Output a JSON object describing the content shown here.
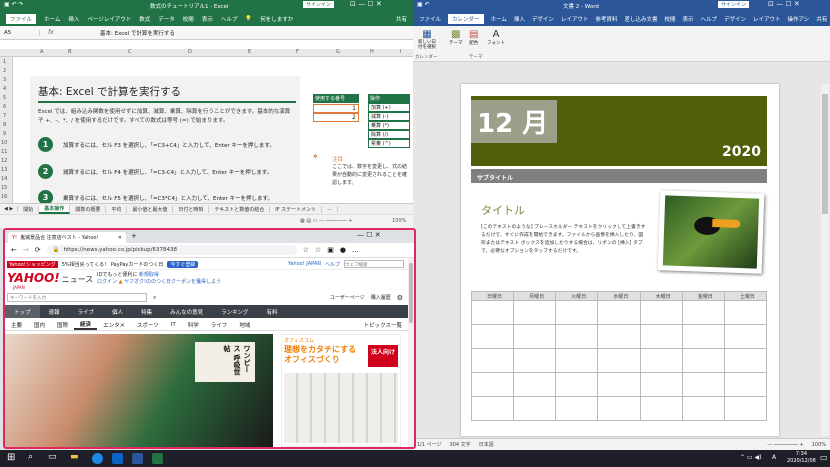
{
  "excel": {
    "title": "数式のチュートリアル1 - Excel",
    "signin": "サインイン",
    "ribbon_tabs": [
      "ファイル",
      "ホーム",
      "挿入",
      "ページレイアウト",
      "数式",
      "データ",
      "校閲",
      "表示",
      "ヘルプ",
      "何をしますか"
    ],
    "share": "共有",
    "name_box": "A5",
    "fx": "fx",
    "formula": "基本: Excel で計算を実行する",
    "columns": [
      "A",
      "B",
      "C",
      "D",
      "E",
      "F",
      "G",
      "H",
      "I"
    ],
    "rows": [
      "1",
      "2",
      "3",
      "4",
      "5",
      "6",
      "7",
      "8",
      "9",
      "10",
      "11",
      "12",
      "13",
      "14",
      "15",
      "16",
      "17"
    ],
    "heading": "基本: Excel で計算を実行する",
    "intro": "Excel では、組み込み関数を使用せずに加算、減算、乗算、除算を行うことができます。基本的な演算子 +、-、*、/ を使用するだけです。すべての数式は等号 (=) で始まります。",
    "steps": [
      {
        "num": "1",
        "text": "加算するには、セル F3 を選択し、「=C3+C4」と入力して、Enter キーを押します。"
      },
      {
        "num": "2",
        "text": "減算するには、セル F4 を選択し、「=C3-C4」と入力して、Enter キーを押します。"
      },
      {
        "num": "3",
        "text": "乗算するには、セル F5 を選択し、「=C3*C4」と入力して、Enter キーを押します。"
      }
    ],
    "table_header": "使用する番号",
    "numbers": [
      "1",
      "2"
    ],
    "ops_header": "操作",
    "ops": [
      "加算 (+)",
      "減算 (-)",
      "乗算 (*)",
      "除算 (/)",
      "累乗 (^)"
    ],
    "note_title": "注目",
    "note_text": "ここでは、数字を変更し、式の結果が自動的に変更されることを確認します。",
    "sheet_tabs": [
      "開始",
      "基本操作",
      "関数の概要",
      "平均",
      "最小値と最大値",
      "日付と時刻",
      "テキストと数値の結合",
      "IF ステートメント"
    ],
    "sheet_more": "...",
    "zoom": "100%"
  },
  "word": {
    "title": "文書 2 - Word",
    "signin": "サインイン",
    "ribbon_tabs": [
      "ファイル",
      "カレンダー",
      "ホーム",
      "挿入",
      "デザイン",
      "レイアウト",
      "参考資料",
      "差し込み文書",
      "校閲",
      "表示",
      "ヘルプ",
      "デザイン",
      "レイアウト",
      "操作アシ",
      "共有"
    ],
    "tools": [
      "新しい日付を選択",
      "テーマ",
      "配色",
      "フォント"
    ],
    "group_labels": [
      "カレンダー",
      "テーマ"
    ],
    "month": "12 月",
    "year": "2020",
    "subtitle": "サブタイトル",
    "doc_title": "タイトル",
    "body": "[このテキストのような] プレースホルダー テキストをクリックして上書きするだけで、すぐに作成を開始できます。ファイルから画像を挿入したり、図形またはテキスト ボックスを追加したりする場合は、リボンの [挿入] タブで、必要なオプションをタップするだけです。",
    "weekdays": [
      "日曜日",
      "月曜日",
      "火曜日",
      "水曜日",
      "木曜日",
      "金曜日",
      "土曜日"
    ],
    "status": [
      "1/1 ページ",
      "304 文字",
      "日本語"
    ],
    "zoom": "100%"
  },
  "browser": {
    "tab_title": "鬼滅景品合 注意店ベスト - Yahoo!",
    "url": "https://news.yahoo.co.jp/pickup/6378438",
    "promo_link": "Yahoo!ショッピング",
    "promo": "5%相当戻ってくる！ PayPayカードのつく日",
    "promo_btn": "今すぐ登録",
    "top_links": [
      "Yahoo! JAPAN",
      "ヘルプ"
    ],
    "search_top_placeholder": "ウェブ検索",
    "logo": "YAHOO!",
    "logo_sub": "JAPAN",
    "logo_news": "ニュース",
    "login_msg": "IDでもっと便利に",
    "login_new": "新規取得",
    "login": "ログイン",
    "coupon": "ヤフオク!ののつく日クーポンを獲得しよう",
    "keyword_placeholder": "キーワードを入力",
    "user_page": "ユーザーページ",
    "history": "購入履歴",
    "nav": [
      "トップ",
      "速報",
      "ライブ",
      "個人",
      "特集",
      "みんなの意見",
      "ランキング",
      "有料"
    ],
    "subnav": [
      "主要",
      "国内",
      "国際",
      "経済",
      "エンタメ",
      "スポーツ",
      "IT",
      "科学",
      "ライフ",
      "地域"
    ],
    "topics": "トピックス一覧",
    "ad_brand": "オフィスコム",
    "ad_headline": "理想をカタチにする オフィスづくり",
    "ad_tag": "法人向け",
    "book": "ワンピース 呼吸世帖"
  },
  "taskbar": {
    "time": "7:34",
    "date": "2020/12/08",
    "lang": "A"
  }
}
